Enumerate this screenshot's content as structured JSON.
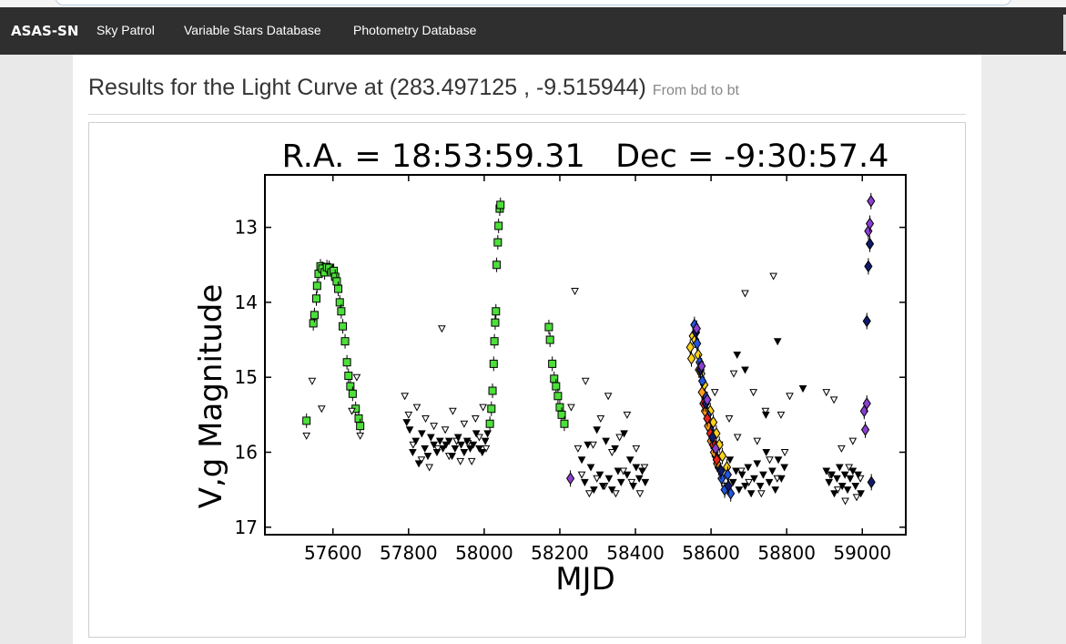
{
  "navbar": {
    "brand": "ASAS-SN",
    "links": [
      "Sky Patrol",
      "Variable Stars Database",
      "Photometry Database"
    ]
  },
  "page": {
    "title": "Results for the Light Curve at (283.497125 , -9.515944)",
    "subtitle": "From bd to bt"
  },
  "colors": {
    "navbar_bg": "#2f2f2f",
    "detection_green": "#4ddf3a",
    "detection_lightgreen": "#8ee23a",
    "upper_limit": "#000000",
    "diamond_purple": "#8a3fd0",
    "diamond_blue": "#2255dd",
    "diamond_yellow": "#ffd21a",
    "diamond_orange": "#ff9a1a",
    "diamond_red": "#e8231a",
    "diamond_navy": "#101a6a"
  },
  "chart_data": {
    "type": "scatter",
    "title": "R.A. = 18:53:59.31   Dec = -9:30:57.4",
    "xlabel": "MJD",
    "ylabel": "V,g Magnitude",
    "xlim": [
      57420,
      59115
    ],
    "ylim": [
      17.1,
      12.3
    ],
    "y_inverted": true,
    "xticks": [
      57600,
      57800,
      58000,
      58200,
      58400,
      58600,
      58800,
      59000
    ],
    "yticks": [
      13,
      14,
      15,
      16,
      17
    ],
    "series": [
      {
        "marker": "square",
        "color": "#4ddf3a",
        "points": [
          [
            57530,
            15.58
          ],
          [
            57548,
            14.28
          ],
          [
            57551,
            14.17
          ],
          [
            57556,
            13.95
          ],
          [
            57558,
            13.78
          ],
          [
            57562,
            13.62
          ],
          [
            57567,
            13.52
          ],
          [
            57572,
            13.55
          ],
          [
            57578,
            13.6
          ],
          [
            57584,
            13.53
          ],
          [
            57590,
            13.54
          ],
          [
            57596,
            13.6
          ],
          [
            57602,
            13.58
          ],
          [
            57606,
            13.66
          ],
          [
            57610,
            13.72
          ],
          [
            57614,
            13.82
          ],
          [
            57618,
            14.0
          ],
          [
            57622,
            14.12
          ],
          [
            57626,
            14.32
          ],
          [
            57632,
            14.52
          ],
          [
            57637,
            14.8
          ],
          [
            57641,
            14.98
          ],
          [
            57646,
            15.12
          ],
          [
            57652,
            15.22
          ],
          [
            57660,
            15.42
          ],
          [
            57668,
            15.55
          ],
          [
            57672,
            15.65
          ],
          [
            58015,
            15.62
          ],
          [
            58019,
            15.42
          ],
          [
            58022,
            15.18
          ],
          [
            58025,
            14.82
          ],
          [
            58027,
            14.52
          ],
          [
            58029,
            14.27
          ],
          [
            58031,
            14.12
          ],
          [
            58033,
            13.5
          ],
          [
            58036,
            13.2
          ],
          [
            58038,
            12.98
          ],
          [
            58041,
            12.75
          ],
          [
            58043,
            12.7
          ],
          [
            58171,
            14.33
          ],
          [
            58174,
            14.5
          ],
          [
            58180,
            14.82
          ],
          [
            58185,
            15.02
          ],
          [
            58190,
            15.12
          ],
          [
            58195,
            15.25
          ],
          [
            58200,
            15.4
          ],
          [
            58205,
            15.5
          ],
          [
            58212,
            15.62
          ]
        ]
      },
      {
        "marker": "triangle-down",
        "color": "#ffffff",
        "points": [
          [
            57530,
            15.78
          ],
          [
            57545,
            15.05
          ],
          [
            57570,
            15.42
          ],
          [
            57650,
            15.45
          ],
          [
            57663,
            15.0
          ],
          [
            57672,
            15.78
          ],
          [
            57790,
            15.25
          ],
          [
            57800,
            15.5
          ],
          [
            57812,
            15.9
          ],
          [
            57822,
            15.4
          ],
          [
            57834,
            16.1
          ],
          [
            57845,
            15.55
          ],
          [
            57855,
            16.2
          ],
          [
            57867,
            15.65
          ],
          [
            57877,
            15.95
          ],
          [
            57888,
            14.35
          ],
          [
            57897,
            15.7
          ],
          [
            57907,
            16.05
          ],
          [
            57917,
            15.45
          ],
          [
            57927,
            15.85
          ],
          [
            57937,
            16.12
          ],
          [
            57947,
            15.62
          ],
          [
            57957,
            15.88
          ],
          [
            57967,
            16.12
          ],
          [
            57977,
            15.55
          ],
          [
            57987,
            15.8
          ],
          [
            57997,
            15.4
          ],
          [
            58005,
            15.95
          ],
          [
            58230,
            15.4
          ],
          [
            58240,
            13.85
          ],
          [
            58248,
            15.95
          ],
          [
            58258,
            16.3
          ],
          [
            58268,
            15.05
          ],
          [
            58278,
            16.55
          ],
          [
            58288,
            15.9
          ],
          [
            58298,
            16.35
          ],
          [
            58308,
            15.55
          ],
          [
            58318,
            16.45
          ],
          [
            58328,
            15.25
          ],
          [
            58338,
            16.0
          ],
          [
            58348,
            16.55
          ],
          [
            58358,
            15.8
          ],
          [
            58368,
            16.25
          ],
          [
            58378,
            15.5
          ],
          [
            58390,
            16.4
          ],
          [
            58402,
            15.95
          ],
          [
            58412,
            16.55
          ],
          [
            58424,
            16.2
          ],
          [
            58610,
            15.2
          ],
          [
            58622,
            15.9
          ],
          [
            58635,
            16.45
          ],
          [
            58648,
            15.55
          ],
          [
            58660,
            14.95
          ],
          [
            58670,
            15.8
          ],
          [
            58680,
            16.25
          ],
          [
            58690,
            13.88
          ],
          [
            58700,
            16.4
          ],
          [
            58712,
            15.2
          ],
          [
            58722,
            15.85
          ],
          [
            58733,
            16.55
          ],
          [
            58744,
            15.45
          ],
          [
            58755,
            16.1
          ],
          [
            58765,
            13.65
          ],
          [
            58775,
            16.35
          ],
          [
            58785,
            15.5
          ],
          [
            58795,
            16.0
          ],
          [
            58808,
            15.25
          ],
          [
            58905,
            15.2
          ],
          [
            58915,
            16.3
          ],
          [
            58925,
            15.3
          ],
          [
            58935,
            16.5
          ],
          [
            58945,
            15.95
          ],
          [
            58955,
            16.65
          ],
          [
            58965,
            16.2
          ],
          [
            58975,
            15.85
          ],
          [
            58985,
            16.6
          ],
          [
            58995,
            16.35
          ]
        ]
      },
      {
        "marker": "triangle-down",
        "color": "#000000",
        "points": [
          [
            57795,
            15.6
          ],
          [
            57803,
            15.7
          ],
          [
            57811,
            16.0
          ],
          [
            57819,
            15.85
          ],
          [
            57827,
            16.15
          ],
          [
            57835,
            15.75
          ],
          [
            57843,
            15.95
          ],
          [
            57851,
            16.05
          ],
          [
            57859,
            15.8
          ],
          [
            57867,
            15.9
          ],
          [
            57875,
            16.0
          ],
          [
            57883,
            15.85
          ],
          [
            57891,
            15.95
          ],
          [
            57899,
            15.9
          ],
          [
            57907,
            15.85
          ],
          [
            57915,
            16.05
          ],
          [
            57923,
            15.95
          ],
          [
            57931,
            15.8
          ],
          [
            57939,
            15.9
          ],
          [
            57947,
            16.0
          ],
          [
            57955,
            15.85
          ],
          [
            57963,
            15.95
          ],
          [
            57971,
            15.9
          ],
          [
            57979,
            15.75
          ],
          [
            57987,
            15.95
          ],
          [
            57995,
            16.0
          ],
          [
            58003,
            15.85
          ],
          [
            58009,
            15.75
          ],
          [
            58258,
            16.1
          ],
          [
            58266,
            16.4
          ],
          [
            58274,
            15.9
          ],
          [
            58282,
            16.2
          ],
          [
            58290,
            16.5
          ],
          [
            58298,
            15.7
          ],
          [
            58306,
            16.3
          ],
          [
            58314,
            16.45
          ],
          [
            58322,
            15.85
          ],
          [
            58330,
            16.35
          ],
          [
            58338,
            16.5
          ],
          [
            58346,
            15.95
          ],
          [
            58354,
            16.25
          ],
          [
            58362,
            16.4
          ],
          [
            58370,
            15.75
          ],
          [
            58378,
            16.3
          ],
          [
            58386,
            16.1
          ],
          [
            58394,
            16.45
          ],
          [
            58402,
            16.2
          ],
          [
            58410,
            16.35
          ],
          [
            58418,
            16.25
          ],
          [
            58426,
            16.4
          ],
          [
            58650,
            16.1
          ],
          [
            58658,
            16.4
          ],
          [
            58666,
            16.25
          ],
          [
            58674,
            16.5
          ],
          [
            58682,
            16.3
          ],
          [
            58690,
            16.45
          ],
          [
            58698,
            16.2
          ],
          [
            58706,
            16.55
          ],
          [
            58714,
            16.35
          ],
          [
            58722,
            16.15
          ],
          [
            58730,
            16.45
          ],
          [
            58738,
            16.3
          ],
          [
            58746,
            16.0
          ],
          [
            58754,
            16.4
          ],
          [
            58762,
            16.25
          ],
          [
            58770,
            16.5
          ],
          [
            58778,
            16.1
          ],
          [
            58786,
            16.35
          ],
          [
            58794,
            16.2
          ],
          [
            58905,
            16.25
          ],
          [
            58912,
            16.4
          ],
          [
            58919,
            16.3
          ],
          [
            58926,
            16.55
          ],
          [
            58933,
            16.35
          ],
          [
            58940,
            16.2
          ],
          [
            58947,
            16.45
          ],
          [
            58954,
            16.3
          ],
          [
            58961,
            16.5
          ],
          [
            58968,
            16.35
          ],
          [
            58975,
            16.25
          ],
          [
            58982,
            16.45
          ],
          [
            58989,
            16.3
          ],
          [
            58996,
            16.55
          ],
          [
            58669,
            14.7
          ],
          [
            58776,
            14.52
          ],
          [
            58843,
            15.15
          ],
          [
            58690,
            14.9
          ],
          [
            58745,
            15.5
          ]
        ]
      },
      {
        "marker": "diamond",
        "color": "#ffd21a",
        "points": [
          [
            58545,
            14.6
          ],
          [
            58548,
            14.75
          ],
          [
            58552,
            14.45
          ],
          [
            58558,
            14.5
          ],
          [
            58566,
            14.7
          ],
          [
            58574,
            14.95
          ],
          [
            58582,
            15.1
          ],
          [
            58590,
            15.3
          ],
          [
            58598,
            15.45
          ],
          [
            58606,
            15.6
          ],
          [
            58614,
            15.75
          ],
          [
            58622,
            15.9
          ],
          [
            58630,
            16.05
          ],
          [
            58642,
            16.2
          ]
        ]
      },
      {
        "marker": "diamond",
        "color": "#2255dd",
        "points": [
          [
            58556,
            14.3
          ],
          [
            58563,
            14.55
          ],
          [
            58570,
            14.8
          ],
          [
            58577,
            15.05
          ],
          [
            58584,
            15.25
          ],
          [
            58591,
            15.5
          ],
          [
            58598,
            15.7
          ],
          [
            58605,
            15.9
          ],
          [
            58612,
            16.05
          ],
          [
            58620,
            16.2
          ],
          [
            58628,
            16.35
          ],
          [
            58636,
            16.5
          ],
          [
            58644,
            16.3
          ],
          [
            58652,
            16.55
          ]
        ]
      },
      {
        "marker": "diamond",
        "color": "#ff9a1a",
        "points": [
          [
            58568,
            14.9
          ],
          [
            58576,
            15.2
          ],
          [
            58584,
            15.45
          ],
          [
            58592,
            15.65
          ],
          [
            58600,
            15.85
          ],
          [
            58608,
            16.0
          ],
          [
            58616,
            16.15
          ]
        ]
      },
      {
        "marker": "diamond",
        "color": "#e8231a",
        "points": [
          [
            58580,
            15.35
          ],
          [
            58590,
            15.55
          ],
          [
            58598,
            15.75
          ],
          [
            58606,
            15.9
          ],
          [
            58615,
            16.1
          ]
        ]
      },
      {
        "marker": "diamond",
        "color": "#101a6a",
        "points": [
          [
            58560,
            14.4
          ],
          [
            58572,
            14.9
          ],
          [
            58586,
            15.35
          ],
          [
            58604,
            15.8
          ],
          [
            58626,
            16.25
          ],
          [
            58646,
            16.45
          ],
          [
            59012,
            14.25
          ],
          [
            59016,
            13.52
          ],
          [
            59020,
            13.22
          ],
          [
            59024,
            16.4
          ]
        ]
      },
      {
        "marker": "diamond",
        "color": "#8a3fd0",
        "points": [
          [
            58562,
            14.35
          ],
          [
            58575,
            14.85
          ],
          [
            58590,
            15.3
          ],
          [
            58612,
            15.95
          ],
          [
            58228,
            16.35
          ],
          [
            59005,
            15.45
          ],
          [
            59008,
            15.7
          ],
          [
            59012,
            15.35
          ],
          [
            59016,
            13.05
          ],
          [
            59020,
            12.95
          ],
          [
            59023,
            12.65
          ]
        ]
      }
    ]
  }
}
